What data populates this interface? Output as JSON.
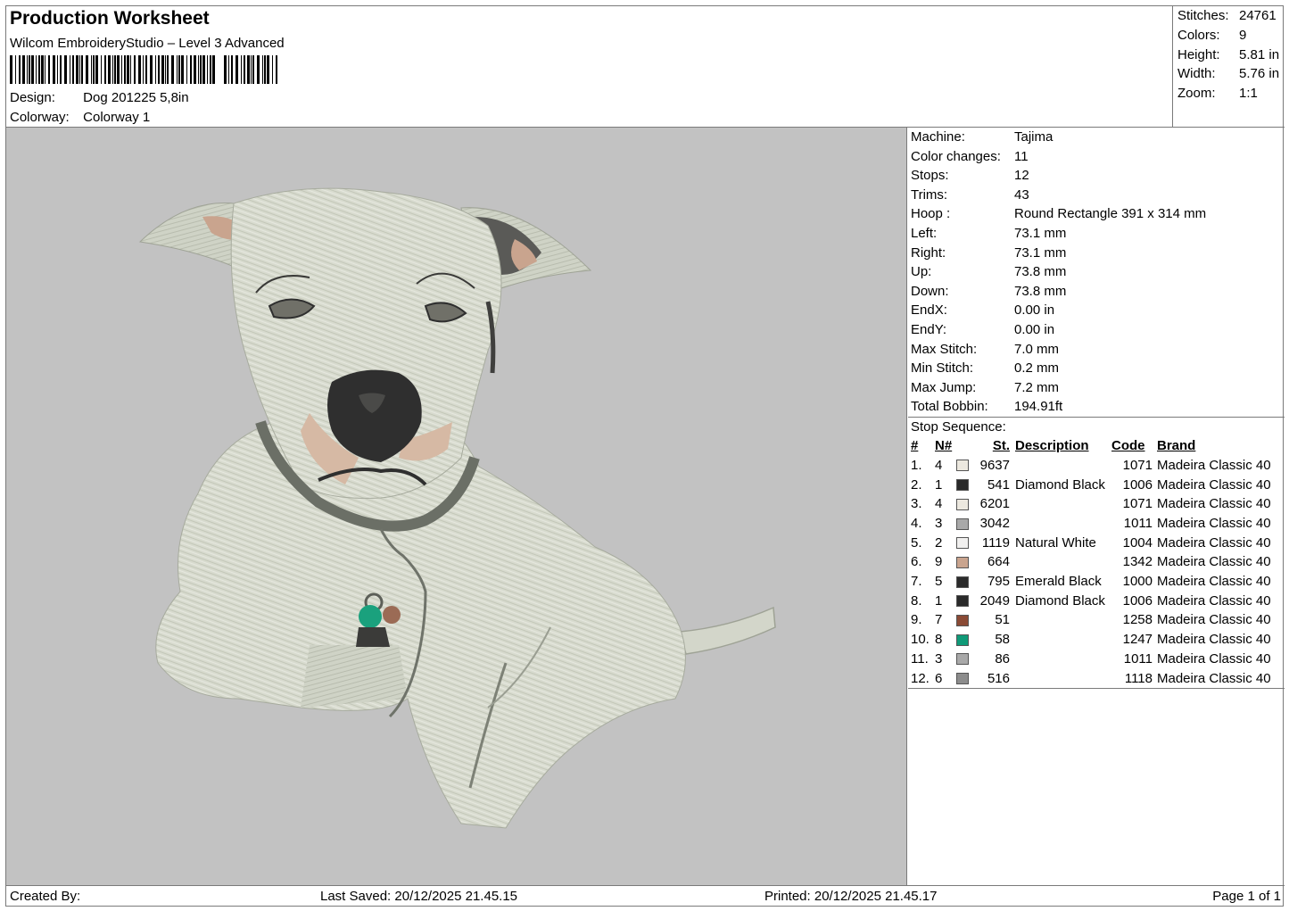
{
  "header": {
    "title": "Production Worksheet",
    "subtitle": "Wilcom EmbroideryStudio – Level 3 Advanced",
    "design_label": "Design:",
    "design_value": "Dog 201225 5,8in",
    "colorway_label": "Colorway:",
    "colorway_value": "Colorway 1"
  },
  "stats": [
    {
      "label": "Stitches:",
      "value": "24761"
    },
    {
      "label": "Colors:",
      "value": "9"
    },
    {
      "label": "Height:",
      "value": "5.81 in"
    },
    {
      "label": "Width:",
      "value": "5.76 in"
    },
    {
      "label": "Zoom:",
      "value": "1:1"
    }
  ],
  "properties": [
    {
      "label": "Machine:",
      "value": "Tajima"
    },
    {
      "label": "Color changes:",
      "value": "11"
    },
    {
      "label": "Stops:",
      "value": "12"
    },
    {
      "label": "Trims:",
      "value": "43"
    },
    {
      "label": "Hoop :",
      "value": "Round Rectangle 391 x 314 mm"
    },
    {
      "label": "Left:",
      "value": "73.1 mm"
    },
    {
      "label": "Right:",
      "value": "73.1 mm"
    },
    {
      "label": "Up:",
      "value": "73.8 mm"
    },
    {
      "label": "Down:",
      "value": "73.8 mm"
    },
    {
      "label": "EndX:",
      "value": "0.00 in"
    },
    {
      "label": "EndY:",
      "value": "0.00 in"
    },
    {
      "label": "Max Stitch:",
      "value": "7.0 mm"
    },
    {
      "label": "Min Stitch:",
      "value": "0.2 mm"
    },
    {
      "label": "Max Jump:",
      "value": "7.2 mm"
    },
    {
      "label": "Total Bobbin:",
      "value": "194.91ft"
    }
  ],
  "stop_sequence": {
    "title": "Stop Sequence:",
    "headers": {
      "idx": "#",
      "n": "N#",
      "st": "St.",
      "desc": "Description",
      "code": "Code",
      "brand": "Brand"
    },
    "rows": [
      {
        "idx": "1.",
        "n": "4",
        "color": "#ece8df",
        "st": "9637",
        "desc": "",
        "code": "1071",
        "brand": "Madeira Classic 40"
      },
      {
        "idx": "2.",
        "n": "1",
        "color": "#2a2a2a",
        "st": "541",
        "desc": "Diamond Black",
        "code": "1006",
        "brand": "Madeira Classic 40"
      },
      {
        "idx": "3.",
        "n": "4",
        "color": "#ece8df",
        "st": "6201",
        "desc": "",
        "code": "1071",
        "brand": "Madeira Classic 40"
      },
      {
        "idx": "4.",
        "n": "3",
        "color": "#a9a9a9",
        "st": "3042",
        "desc": "",
        "code": "1011",
        "brand": "Madeira Classic 40"
      },
      {
        "idx": "5.",
        "n": "2",
        "color": "#f1f0ef",
        "st": "1119",
        "desc": "Natural White",
        "code": "1004",
        "brand": "Madeira Classic 40"
      },
      {
        "idx": "6.",
        "n": "9",
        "color": "#c9a48e",
        "st": "664",
        "desc": "",
        "code": "1342",
        "brand": "Madeira Classic 40"
      },
      {
        "idx": "7.",
        "n": "5",
        "color": "#2b2b2b",
        "st": "795",
        "desc": "Emerald Black",
        "code": "1000",
        "brand": "Madeira Classic 40"
      },
      {
        "idx": "8.",
        "n": "1",
        "color": "#2a2a2a",
        "st": "2049",
        "desc": "Diamond Black",
        "code": "1006",
        "brand": "Madeira Classic 40"
      },
      {
        "idx": "9.",
        "n": "7",
        "color": "#8a4a35",
        "st": "51",
        "desc": "",
        "code": "1258",
        "brand": "Madeira Classic 40"
      },
      {
        "idx": "10.",
        "n": "8",
        "color": "#0f9a78",
        "st": "58",
        "desc": "",
        "code": "1247",
        "brand": "Madeira Classic 40"
      },
      {
        "idx": "11.",
        "n": "3",
        "color": "#a9a9a9",
        "st": "86",
        "desc": "",
        "code": "1011",
        "brand": "Madeira Classic 40"
      },
      {
        "idx": "12.",
        "n": "6",
        "color": "#8c8c8c",
        "st": "516",
        "desc": "",
        "code": "1118",
        "brand": "Madeira Classic 40"
      }
    ]
  },
  "footer": {
    "created_by": "Created By:",
    "last_saved": "Last Saved: 20/12/2025 21.45.15",
    "printed": "Printed: 20/12/2025 21.45.17",
    "page": "Page 1 of 1"
  },
  "colors": {
    "background": "#c2c2c2",
    "thread_body": "#d6d9cc",
    "thread_dark": "#2f2f2f"
  }
}
